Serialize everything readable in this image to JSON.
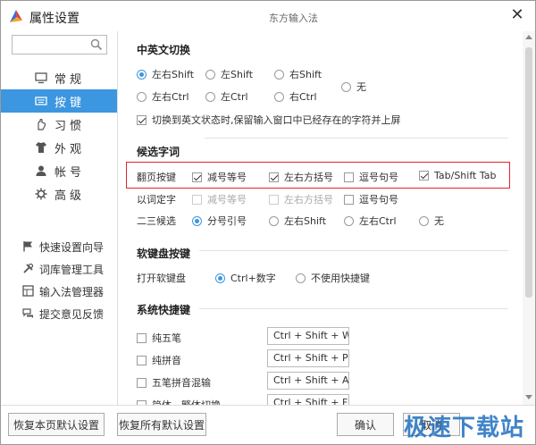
{
  "window": {
    "title": "属性设置",
    "ime_name": "东方输入法",
    "close_glyph": "✕"
  },
  "sidebar": {
    "search_placeholder": "",
    "nav": [
      {
        "label": "常规",
        "icon": "monitor-icon",
        "active": false
      },
      {
        "label": "按键",
        "icon": "keyboard-icon",
        "active": true
      },
      {
        "label": "习惯",
        "icon": "hand-icon",
        "active": false
      },
      {
        "label": "外观",
        "icon": "shirt-icon",
        "active": false
      },
      {
        "label": "帐号",
        "icon": "user-icon",
        "active": false
      },
      {
        "label": "高级",
        "icon": "gear-icon",
        "active": false
      }
    ],
    "tools": [
      {
        "label": "快速设置向导",
        "icon": "flag-icon"
      },
      {
        "label": "词库管理工具",
        "icon": "tools-icon"
      },
      {
        "label": "输入法管理器",
        "icon": "grid-icon"
      },
      {
        "label": "提交意见反馈",
        "icon": "chat-icon"
      }
    ]
  },
  "main": {
    "section_switch": {
      "title": "中英文切换",
      "options": [
        "左右Shift",
        "左Shift",
        "右Shift",
        "左右Ctrl",
        "左Ctrl",
        "右Ctrl",
        "无"
      ],
      "selected": "左右Shift",
      "keep_text_label": "切换到英文状态时,保留输入窗口中已经存在的字符并上屏",
      "keep_text_checked": true
    },
    "section_candidates": {
      "title": "候选字词",
      "page_keys_label": "翻页按键",
      "page_keys": [
        {
          "label": "减号等号",
          "checked": true
        },
        {
          "label": "左右方括号",
          "checked": true
        },
        {
          "label": "逗号句号",
          "checked": false
        },
        {
          "label": "Tab/Shift Tab",
          "checked": true
        }
      ],
      "select_word_label": "以词定字",
      "select_word": [
        {
          "label": "减号等号",
          "checked": false,
          "disabled": true
        },
        {
          "label": "左右方括号",
          "checked": false,
          "disabled": true
        },
        {
          "label": "逗号句号",
          "checked": false,
          "disabled": false
        }
      ],
      "second_third_label": "二三候选",
      "second_third": [
        "分号引号",
        "左右Shift",
        "左右Ctrl",
        "无"
      ],
      "second_third_selected": "分号引号"
    },
    "section_softkbd": {
      "title": "软键盘按键",
      "open_label": "打开软键盘",
      "options": [
        "Ctrl+数字",
        "不使用快捷键"
      ],
      "selected": "Ctrl+数字"
    },
    "section_hotkeys": {
      "title": "系统快捷键",
      "items": [
        {
          "label": "纯五笔",
          "hotkey": "Ctrl + Shift + W",
          "checked": false
        },
        {
          "label": "纯拼音",
          "hotkey": "Ctrl + Shift + P",
          "checked": false
        },
        {
          "label": "五笔拼音混输",
          "hotkey": "Ctrl + Shift + A",
          "checked": false
        },
        {
          "label": "简体 - 繁体切换",
          "hotkey": "Ctrl + Shift + F",
          "checked": false
        }
      ]
    }
  },
  "buttons": {
    "restore_page": "恢复本页默认设置",
    "restore_all": "恢复所有默认设置",
    "ok": "确认",
    "cancel": "取消"
  },
  "watermark": "极速下载站",
  "colors": {
    "accent": "#3c96e0",
    "highlight_border": "#e0262c",
    "watermark": "#1f6fbf"
  }
}
